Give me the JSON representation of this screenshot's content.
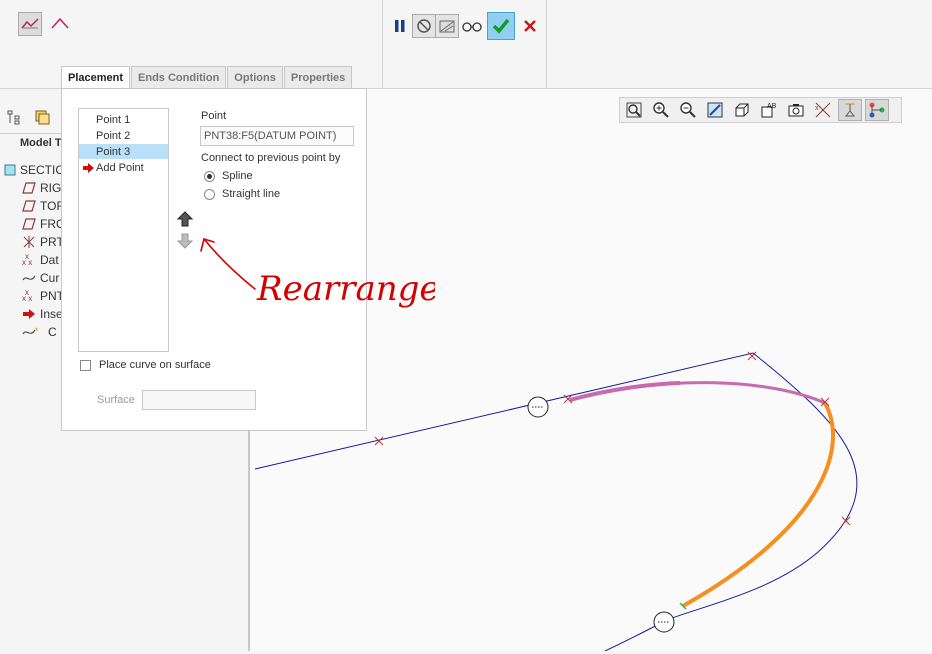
{
  "ribbon": {
    "left_icons": [
      "spline-curve-icon",
      "polyline-curve-icon"
    ],
    "actions": {
      "pause": "pause-icon",
      "no_preview": "no-preview-icon",
      "preview": "preview-icon",
      "verify": "glasses-icon",
      "ok": "checkmark-icon",
      "cancel": "cancel-icon"
    }
  },
  "tabs": [
    {
      "label": "Placement",
      "active": true
    },
    {
      "label": "Ends Condition",
      "active": false
    },
    {
      "label": "Options",
      "active": false
    },
    {
      "label": "Properties",
      "active": false
    }
  ],
  "placement": {
    "points": [
      "Point 1",
      "Point 2",
      "Point 3"
    ],
    "selected_point": "Point 3",
    "add_point": "Add Point",
    "point_label": "Point",
    "point_value": "PNT38:F5(DATUM POINT)",
    "connect_label": "Connect to previous point by",
    "options": [
      {
        "label": "Spline",
        "checked": true
      },
      {
        "label": "Straight line",
        "checked": false
      }
    ],
    "place_on_surface": "Place curve on surface",
    "surface_label": "Surface",
    "surface_value": ""
  },
  "annotation": {
    "text": "Rearrange",
    "color": "#d40000"
  },
  "model_tree": {
    "title": "Model T",
    "items": [
      {
        "label": "SECTIC",
        "icon": "part-icon"
      },
      {
        "label": "RIG",
        "icon": "datum-plane-icon"
      },
      {
        "label": "TOF",
        "icon": "datum-plane-icon"
      },
      {
        "label": "FRO",
        "icon": "datum-plane-icon"
      },
      {
        "label": "PRT",
        "icon": "coordinate-system-icon"
      },
      {
        "label": "Dat",
        "icon": "datum-point-icon"
      },
      {
        "label": "Cur",
        "icon": "curve-icon"
      },
      {
        "label": "PNT",
        "icon": "datum-point-icon"
      },
      {
        "label": "Inse",
        "icon": "insert-here-arrow-icon"
      },
      {
        "label": "C",
        "icon": "curve-feature-icon"
      }
    ]
  },
  "view_toolbar": [
    "refit-icon",
    "zoom-in-icon",
    "zoom-out-icon",
    "repaint-icon",
    "display-style-icon",
    "saved-orientations-icon",
    "saved-views-icon",
    "datum-display-icon",
    "spin-center-icon",
    "annotation-display-icon"
  ],
  "colors": {
    "curve_blue": "#1a1aa0",
    "curve_pink": "#c86ab0",
    "curve_orange": "#f5901e",
    "point_red": "#c0303a"
  }
}
